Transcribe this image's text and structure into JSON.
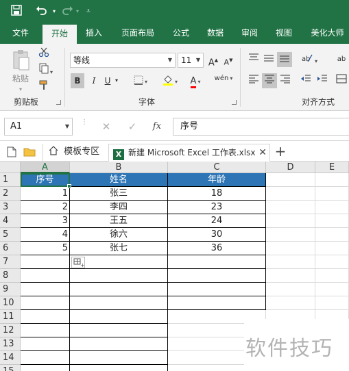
{
  "quick_access": {
    "save_icon": "save-icon",
    "undo_icon": "undo-icon",
    "redo_icon": "redo-icon",
    "customize_icon": "customize-icon"
  },
  "ribbon_tabs": [
    "文件",
    "开始",
    "插入",
    "页面布局",
    "公式",
    "数据",
    "审阅",
    "视图",
    "美化大师"
  ],
  "active_tab": "开始",
  "clipboard": {
    "paste_label": "粘贴",
    "group_label": "剪贴板"
  },
  "font": {
    "name": "等线",
    "size": "11",
    "bold": "B",
    "italic": "I",
    "underline": "U",
    "font_color_letter": "A",
    "phonetic": "wén",
    "group_label": "字体",
    "grow": "A",
    "shrink": "A"
  },
  "alignment": {
    "group_label": "对齐方式"
  },
  "name_box": "A1",
  "fx_label": "fx",
  "formula_value": "序号",
  "doc_tabs": {
    "template_label": "模板专区",
    "workbook_label": "新建 Microsoft Excel 工作表.xlsx",
    "xl_badge": "X",
    "add_label": "+"
  },
  "sheet": {
    "columns": [
      "A",
      "B",
      "C",
      "D",
      "E"
    ],
    "rows": [
      "1",
      "2",
      "3",
      "4",
      "5",
      "6",
      "7",
      "8",
      "9",
      "10",
      "11",
      "12",
      "13",
      "14",
      "15"
    ],
    "headers": [
      "序号",
      "姓名",
      "年龄"
    ],
    "data": [
      [
        "1",
        "张三",
        "18"
      ],
      [
        "2",
        "李四",
        "23"
      ],
      [
        "3",
        "王五",
        "24"
      ],
      [
        "4",
        "徐六",
        "30"
      ],
      [
        "5",
        "张七",
        "36"
      ]
    ],
    "header_fill": "#2e75b6",
    "active_cell": "A1"
  },
  "colors": {
    "brand": "#217346",
    "highlight_bar": "#ffff00",
    "font_color_bar": "#ff0000"
  },
  "watermark": "软件技巧"
}
